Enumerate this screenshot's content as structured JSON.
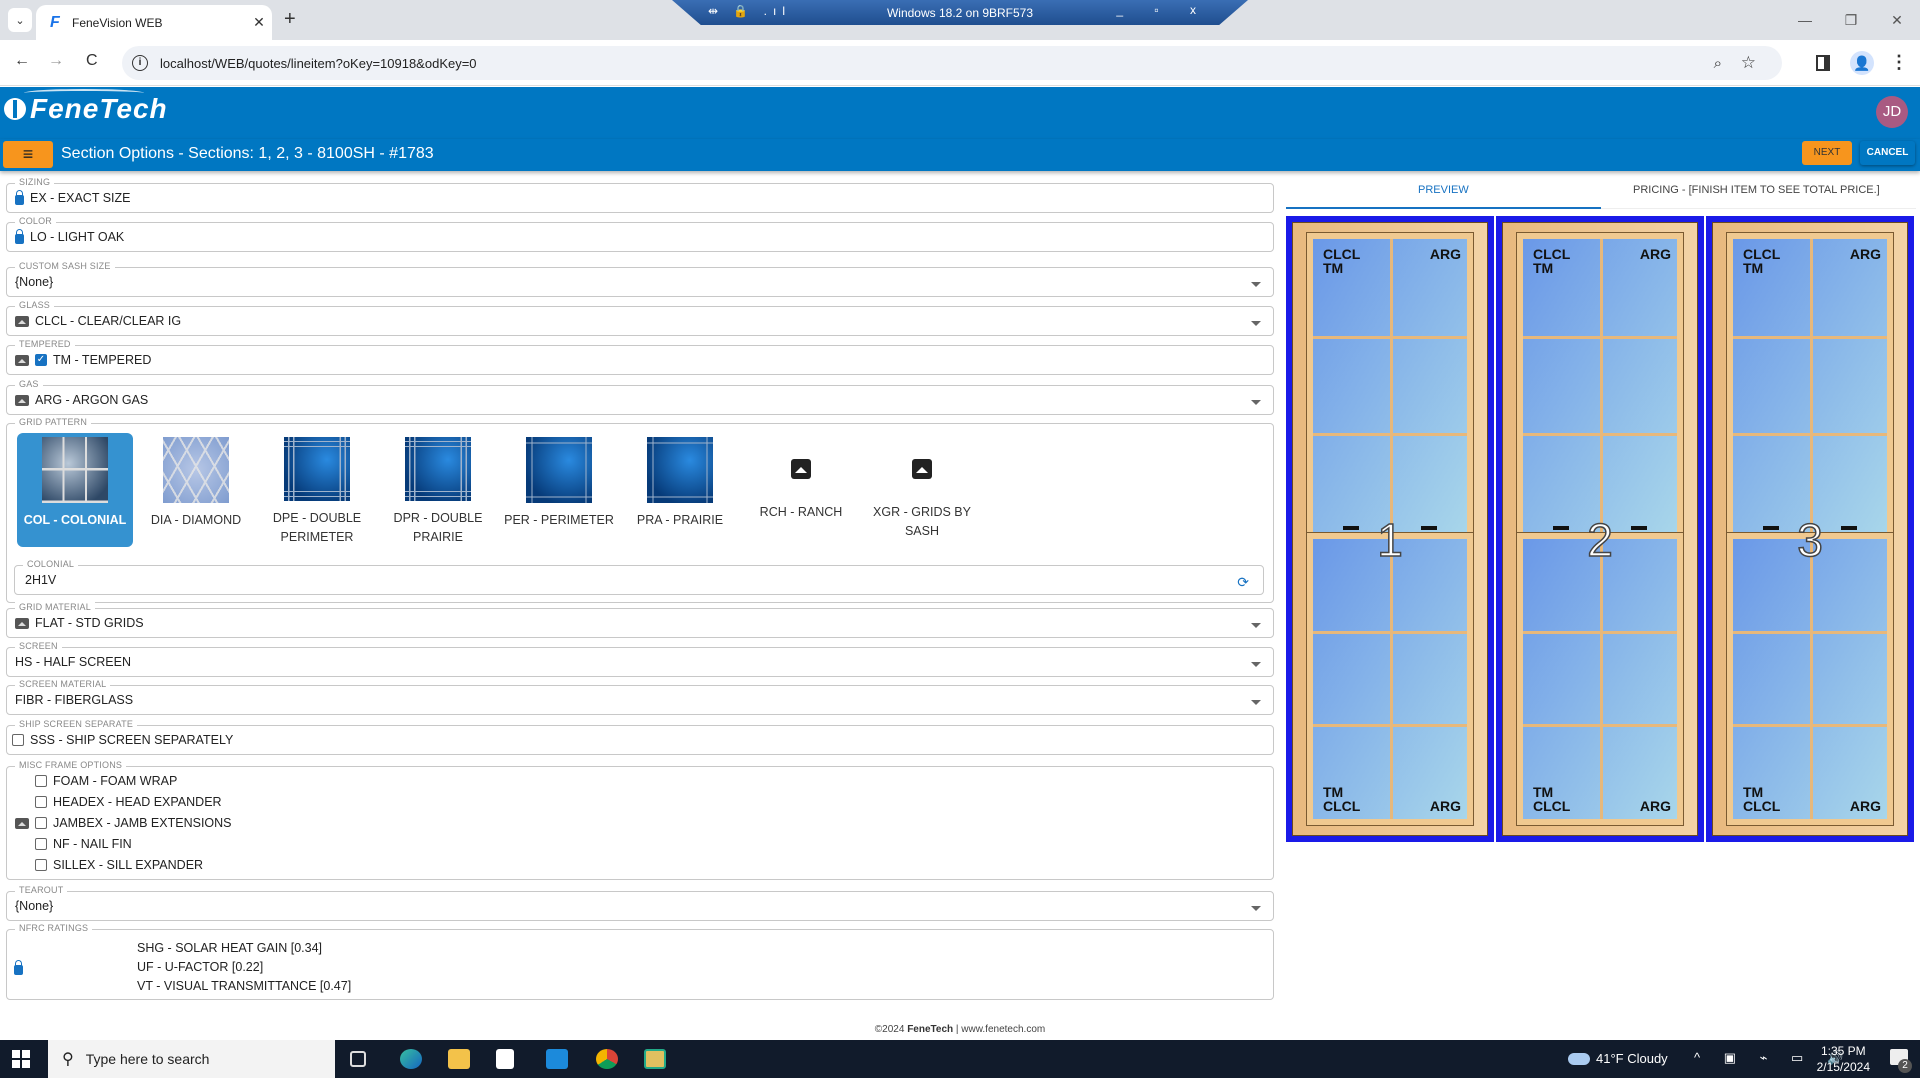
{
  "browser": {
    "tab_title": "FeneVision WEB",
    "tab_favicon": "F",
    "tab_close": "✕",
    "new_tab": "+",
    "url": "localhost/WEB/quotes/lineitem?oKey=10918&odKey=0",
    "back": "←",
    "forward": "→",
    "reload": "C",
    "profile_icon": "👤",
    "menu": "⋮"
  },
  "rdp_bar": {
    "title": "Windows 18.2 on 9BRF573",
    "left_icons": "⇹ 🔒 .ıl",
    "right_icons": "_ ▫ x"
  },
  "window_controls": {
    "minimize": "—",
    "restore": "❐",
    "close": "✕"
  },
  "app": {
    "brand": "FeneTech",
    "user_initials": "JD",
    "menu_icon": "≡",
    "page_title": "Section Options - Sections: 1, 2, 3 - 8100SH - #1783",
    "next_label": "NEXT",
    "cancel_label": "CANCEL",
    "accent_color": "#0077c2",
    "button_color": "#f7951d"
  },
  "form": {
    "sizing": {
      "label": "SIZING",
      "value": "EX - EXACT SIZE",
      "locked": true
    },
    "color": {
      "label": "COLOR",
      "value": "LO - LIGHT OAK",
      "locked": true
    },
    "custom_sash_size": {
      "label": "CUSTOM SASH SIZE",
      "value": "{None}"
    },
    "glass": {
      "label": "GLASS",
      "value": "CLCL - CLEAR/CLEAR IG"
    },
    "tempered": {
      "label": "TEMPERED",
      "value": "TM - TEMPERED",
      "checked": true,
      "check": "✓"
    },
    "gas": {
      "label": "GAS",
      "value": "ARG - ARGON GAS"
    },
    "grid_pattern": {
      "label": "GRID PATTERN",
      "selected": "COL - COLONIAL",
      "options": [
        {
          "label": "COL - COLONIAL"
        },
        {
          "label": "DIA - DIAMOND"
        },
        {
          "label": "DPE - DOUBLE PERIMETER"
        },
        {
          "label": "DPR - DOUBLE PRAIRIE"
        },
        {
          "label": "PER - PERIMETER"
        },
        {
          "label": "PRA - PRAIRIE"
        },
        {
          "label": "RCH - RANCH"
        },
        {
          "label": "XGR - GRIDS BY SASH"
        }
      ],
      "colonial": {
        "label": "COLONIAL",
        "value": "2H1V",
        "refresh_icon": "⟳"
      }
    },
    "grid_material": {
      "label": "GRID MATERIAL",
      "value": "FLAT - STD GRIDS"
    },
    "screen": {
      "label": "SCREEN",
      "value": "HS - HALF SCREEN"
    },
    "screen_material": {
      "label": "SCREEN MATERIAL",
      "value": "FIBR - FIBERGLASS"
    },
    "ship_screen_separate": {
      "label": "SHIP SCREEN SEPARATE",
      "value": "SSS - SHIP SCREEN SEPARATELY",
      "checked": false
    },
    "misc_frame_options": {
      "label": "MISC FRAME OPTIONS",
      "items": [
        {
          "label": "FOAM - FOAM WRAP",
          "checked": false
        },
        {
          "label": "HEADEX - HEAD EXPANDER",
          "checked": false
        },
        {
          "label": "JAMBEX - JAMB EXTENSIONS",
          "checked": false
        },
        {
          "label": "NF - NAIL FIN",
          "checked": false
        },
        {
          "label": "SILLEX - SILL EXPANDER",
          "checked": false
        }
      ]
    },
    "tearout": {
      "label": "TEAROUT",
      "value": "{None}"
    },
    "nfrc_ratings": {
      "label": "NFRC RATINGS",
      "items": [
        "SHG - SOLAR HEAT GAIN [0.34]",
        "UF - U-FACTOR [0.22]",
        "VT - VISUAL TRANSMITTANCE [0.47]"
      ]
    }
  },
  "preview_panel": {
    "tabs": [
      {
        "label": "PREVIEW",
        "active": true
      },
      {
        "label": "PRICING - [FINISH ITEM TO SEE TOTAL PRICE.]",
        "active": false
      }
    ],
    "sections": [
      {
        "number": "1",
        "top_left": "CLCL\nTM",
        "top_right": "ARG",
        "bottom_left": "TM\nCLCL",
        "bottom_right": "ARG"
      },
      {
        "number": "2",
        "top_left": "CLCL\nTM",
        "top_right": "ARG",
        "bottom_left": "TM\nCLCL",
        "bottom_right": "ARG"
      },
      {
        "number": "3",
        "top_left": "CLCL\nTM",
        "top_right": "ARG",
        "bottom_left": "TM\nCLCL",
        "bottom_right": "ARG"
      }
    ]
  },
  "footer": {
    "copyright": "©2024 ",
    "brand": "FeneTech",
    "sep": " | ",
    "site": "www.fenetech.com"
  },
  "taskbar": {
    "search_placeholder": "Type here to search",
    "weather": "41°F  Cloudy",
    "time": "1:35 PM",
    "date": "2/15/2024",
    "notifications": "2",
    "tray_icons": "^ ▣ ⌁ ▭ 🔊"
  }
}
